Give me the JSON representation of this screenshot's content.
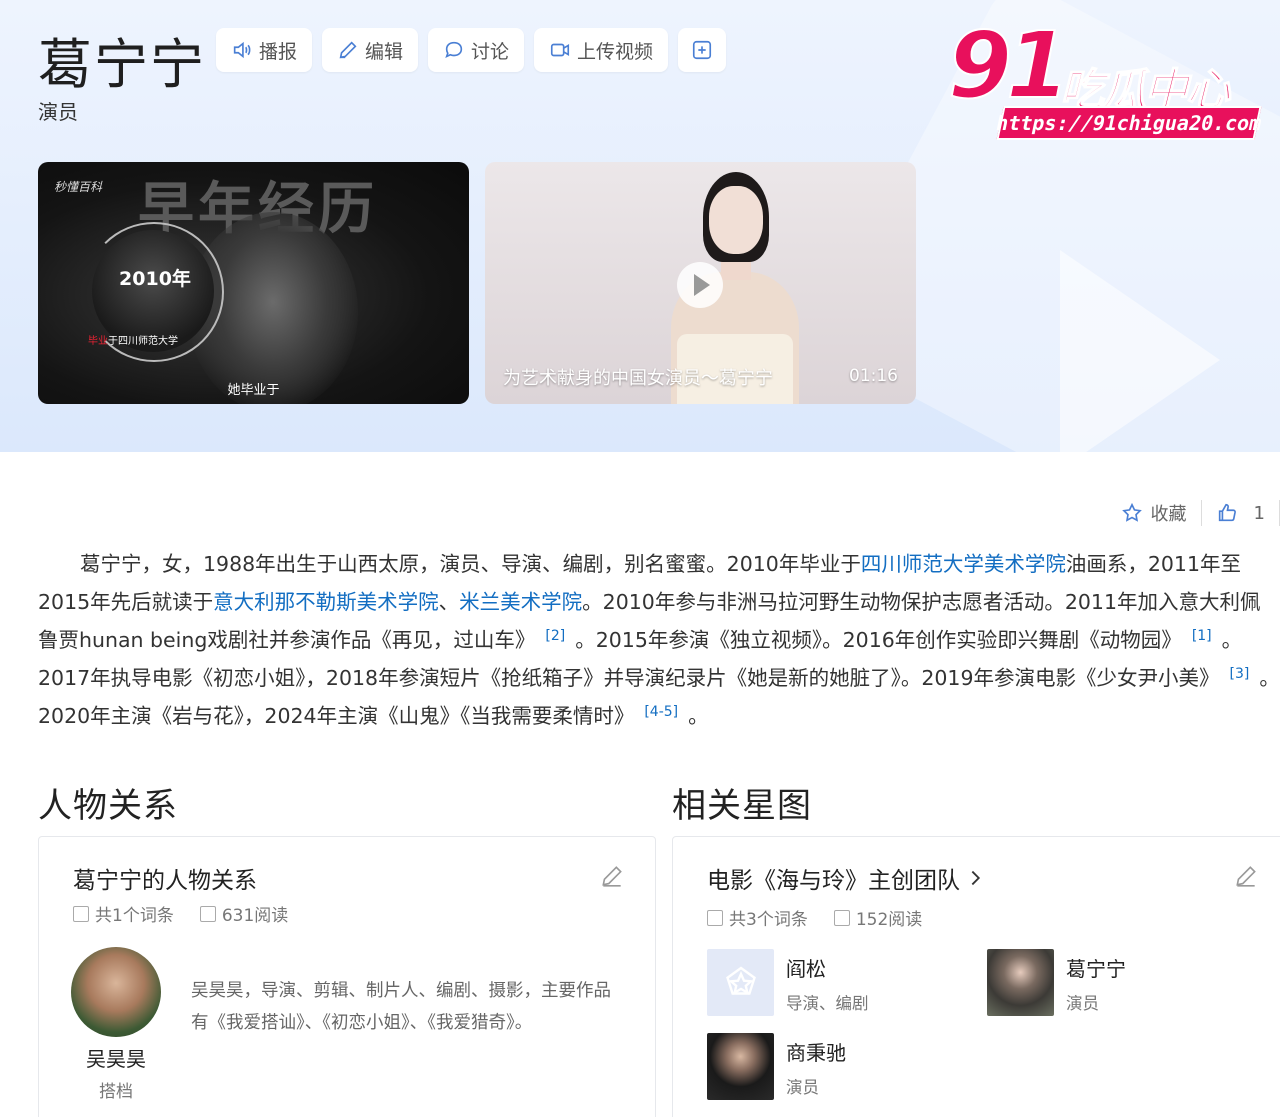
{
  "header": {
    "title": "葛宁宁",
    "subtitle": "演员",
    "toolbar": [
      {
        "label": "播报",
        "icon": "speaker-icon"
      },
      {
        "label": "编辑",
        "icon": "pencil-icon"
      },
      {
        "label": "讨论",
        "icon": "chat-bubble-icon"
      },
      {
        "label": "上传视频",
        "icon": "video-camera-icon"
      }
    ],
    "more_icon": "plus-square-icon"
  },
  "watermark": {
    "big": "91",
    "text": "吃瓜中心",
    "url": "https://91chigua20.com",
    "color": "#e8105c"
  },
  "videos": [
    {
      "brand": "秒懂百科",
      "heading": "早年经历",
      "year": "2010年",
      "grad_text_red": "毕业",
      "grad_text": "于四川师范大学",
      "caption": "她毕业于"
    },
    {
      "title": "为艺术献身的中国女演员～葛宁宁",
      "duration": "01:16"
    }
  ],
  "actions": {
    "collect_label": "收藏",
    "like_count": "1"
  },
  "summary": {
    "p1": "葛宁宁，女，1988年出生于山西太原，演员、导演、编剧，别名蜜蜜。2010年毕业于",
    "link1": "四川师范大学美术学院",
    "p2": "油画系，2011年至2015年先后就读于",
    "link2": "意大利那不勒斯美术学院",
    "p3": "、",
    "link3": "米兰美术学院",
    "p4": "。2010年参与非洲马拉河野生动物保护志愿者活动。2011年加入意大利佩鲁贾hunan being戏剧社并参演作品《再见，过山车》",
    "ref2": "[2]",
    "p5": "。2015年参演《独立视频》。2016年创作实验即兴舞剧《动物园》",
    "ref1": "[1]",
    "p6": "。2017年执导电影《初恋小姐》，2018年参演短片《抢纸箱子》并导演纪录片《她是新的她脏了》。2019年参演电影《少女尹小美》",
    "ref3": "[3]",
    "p7": "。2020年主演《岩与花》，2024年主演《山鬼》《当我需要柔情时》",
    "ref45": "[4-5]",
    "p8": "。"
  },
  "relations": {
    "section_title": "人物关系",
    "card_title": "葛宁宁的人物关系",
    "entries": "共1个词条",
    "reads": "631阅读",
    "person": {
      "name": "吴昊昊",
      "role": "搭档",
      "desc": "吴昊昊，导演、剪辑、制片人、编剧、摄影，主要作品有《我爱搭讪》、《初恋小姐》、《我爱猎奇》。"
    }
  },
  "stars": {
    "section_title": "相关星图",
    "card_title": "电影《海与玲》主创团队",
    "entries": "共3个词条",
    "reads": "152阅读",
    "members": [
      {
        "name": "阎松",
        "role": "导演、编剧"
      },
      {
        "name": "葛宁宁",
        "role": "演员"
      },
      {
        "name": "商秉驰",
        "role": "演员"
      }
    ]
  }
}
